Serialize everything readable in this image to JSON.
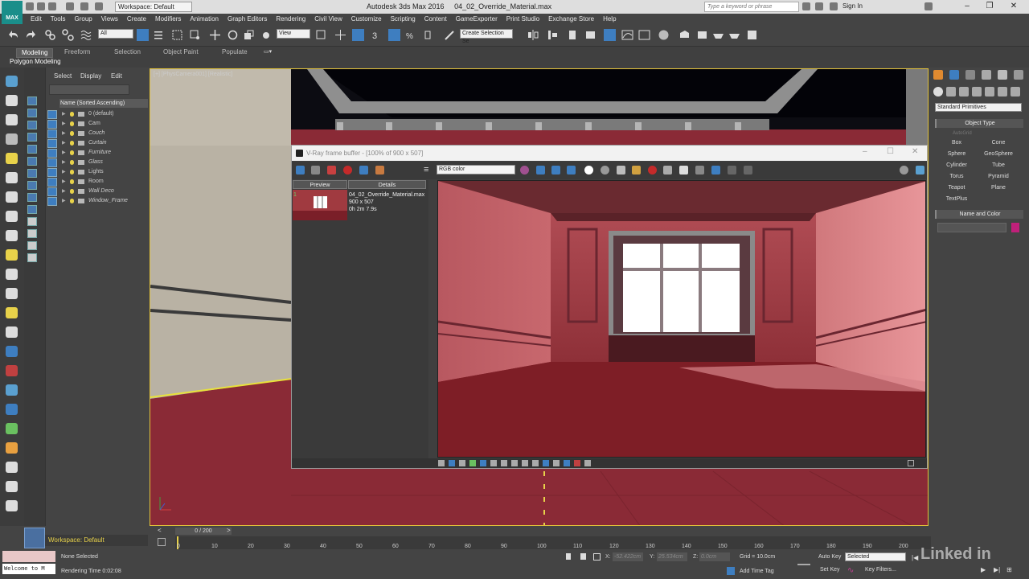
{
  "titlebar": {
    "workspace": "Workspace: Default",
    "app_title": "Autodesk 3ds Max 2016",
    "file_name": "04_02_Override_Material.max",
    "search_placeholder": "Type a keyword or phrase",
    "sign_in": "Sign In",
    "logo_label": "MAX"
  },
  "menus": [
    "Edit",
    "Tools",
    "Group",
    "Views",
    "Create",
    "Modifiers",
    "Animation",
    "Graph Editors",
    "Rendering",
    "Civil View",
    "Customize",
    "Scripting",
    "Content",
    "GameExporter",
    "Print Studio",
    "Exchange Store",
    "Help"
  ],
  "toolbar": {
    "filter": "All",
    "ref_coord": "View",
    "selection_set": "Create Selection Se"
  },
  "ribbon": {
    "tabs": [
      "Modeling",
      "Freeform",
      "Selection",
      "Object Paint",
      "Populate"
    ],
    "sub_label": "Polygon Modeling"
  },
  "scene_explorer": {
    "tabs": [
      "Select",
      "Display",
      "Edit"
    ],
    "column_header": "Name (Sorted Ascending)",
    "layers": [
      "0 (default)",
      "Cam",
      "Couch",
      "Curtain",
      "Furniture",
      "Glass",
      "Lights",
      "Room",
      "Wall Deco",
      "Window_Frame"
    ]
  },
  "viewport": {
    "label": "[+] [PhysCamera001] [Realistic]"
  },
  "vfb": {
    "title": "V-Ray frame buffer - [100% of 900 x 507]",
    "channel": "RGB color",
    "history_tabs": [
      "Preview",
      "Details"
    ],
    "thumb_index": "1",
    "thumb_name": "04_02_Override_Material.max",
    "thumb_res": "900 x 507",
    "thumb_time": "0h 2m 7.9s"
  },
  "command_panel": {
    "category": "Standard Primitives",
    "object_type_header": "Object Type",
    "autogrid": "AutoGrid",
    "primitives": [
      "Box",
      "Cone",
      "Sphere",
      "GeoSphere",
      "Cylinder",
      "Tube",
      "Torus",
      "Pyramid",
      "Teapot",
      "Plane",
      "TextPlus"
    ],
    "name_color_header": "Name and Color",
    "object_color": "#c0207a"
  },
  "bottom": {
    "workspace": "Workspace: Default",
    "time_slider": "0 / 200",
    "ticks": [
      "0",
      "10",
      "20",
      "30",
      "40",
      "50",
      "60",
      "70",
      "80",
      "90",
      "100",
      "110",
      "120",
      "130",
      "140",
      "150",
      "160",
      "170",
      "180",
      "190",
      "200"
    ],
    "listener": "Welcome to M",
    "status_selection": "None Selected",
    "status_render": "Rendering Time  0:02:08",
    "x_label": "X:",
    "x_value": "-52.422cm",
    "y_label": "Y:",
    "y_value": "25.534cm",
    "z_label": "Z:",
    "z_value": "0.0cm",
    "grid": "Grid = 10.0cm",
    "add_time_tag": "Add Time Tag",
    "auto_key": "Auto Key",
    "set_key": "Set Key",
    "key_mode": "Selected",
    "key_filters": "Key Filters...",
    "watermark": "Linked in"
  },
  "colors": {
    "viewport_border": "#e2c23a",
    "floor": "#8a2a36",
    "logo": "#1a8e8a",
    "selection_highlight": "#3e7ec0"
  }
}
